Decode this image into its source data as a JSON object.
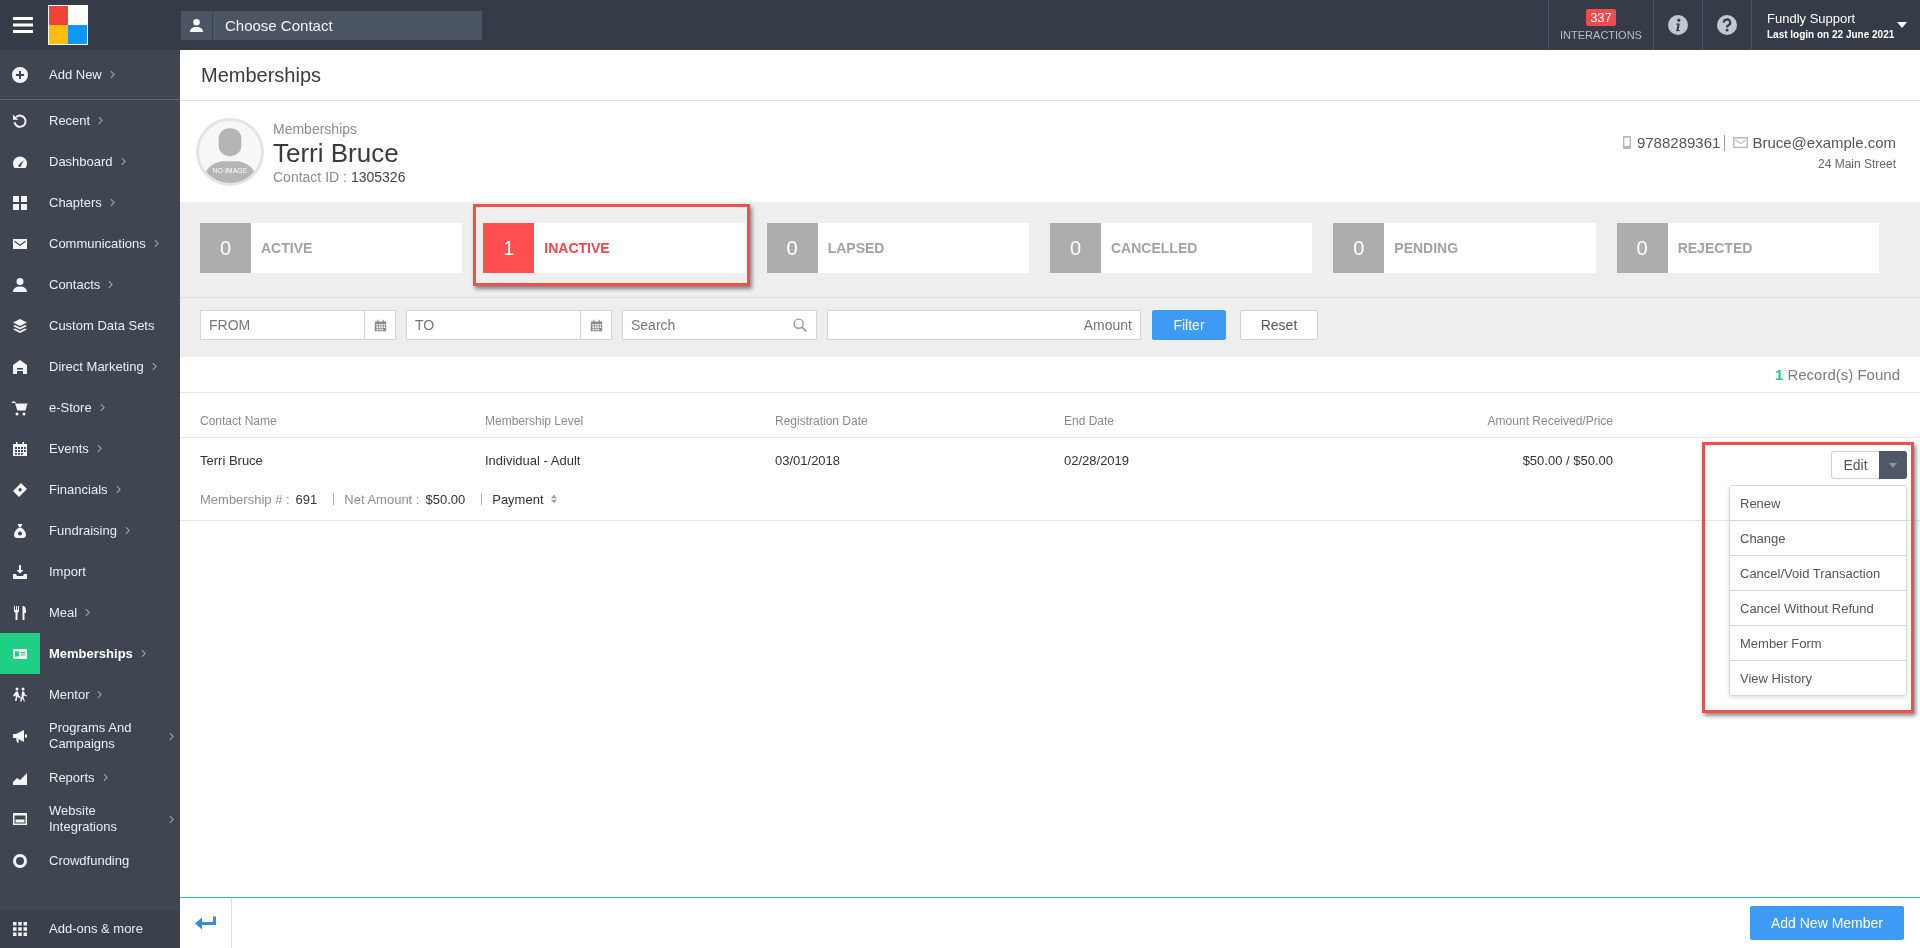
{
  "topbar": {
    "contact_picker": {
      "placeholder": "Choose Contact"
    },
    "interactions": {
      "count": "337",
      "label": "INTERACTIONS"
    },
    "user": {
      "name": "Fundly Support",
      "last_login": "Last login on 22 June 2021"
    }
  },
  "sidebar": {
    "add_new": {
      "label": "Add New",
      "submenu": true
    },
    "items": [
      {
        "label": "Recent",
        "submenu": true,
        "selected": false
      },
      {
        "label": "Dashboard",
        "submenu": true,
        "selected": false
      },
      {
        "label": "Chapters",
        "submenu": true,
        "selected": false
      },
      {
        "label": "Communications",
        "submenu": true,
        "selected": false
      },
      {
        "label": "Contacts",
        "submenu": true,
        "selected": false
      },
      {
        "label": "Custom Data Sets",
        "submenu": false,
        "selected": false
      },
      {
        "label": "Direct Marketing",
        "submenu": true,
        "selected": false
      },
      {
        "label": "e-Store",
        "submenu": true,
        "selected": false
      },
      {
        "label": "Events",
        "submenu": true,
        "selected": false
      },
      {
        "label": "Financials",
        "submenu": true,
        "selected": false
      },
      {
        "label": "Fundraising",
        "submenu": true,
        "selected": false
      },
      {
        "label": "Import",
        "submenu": false,
        "selected": false
      },
      {
        "label": "Meal",
        "submenu": true,
        "selected": false
      },
      {
        "label": "Memberships",
        "submenu": true,
        "selected": true
      },
      {
        "label": "Mentor",
        "submenu": true,
        "selected": false
      },
      {
        "label": "Programs And Campaigns",
        "submenu": true,
        "selected": false
      },
      {
        "label": "Reports",
        "submenu": true,
        "selected": false
      },
      {
        "label": "Website Integrations",
        "submenu": true,
        "selected": false
      },
      {
        "label": "Crowdfunding",
        "submenu": false,
        "selected": false
      }
    ],
    "footer": {
      "label": "Add-ons & more"
    }
  },
  "page": {
    "title": "Memberships"
  },
  "contact": {
    "section": "Memberships",
    "name": "Terri Bruce",
    "id_label": "Contact ID :",
    "id": "1305326",
    "avatar_caption": "NO IMAGE",
    "phone": "9788289361",
    "email": "Bruce@example.com",
    "address": "24 Main Street"
  },
  "status_tiles": [
    {
      "count": "0",
      "label": "ACTIVE",
      "selected": false,
      "highlighted": false
    },
    {
      "count": "1",
      "label": "INACTIVE",
      "selected": true,
      "highlighted": true
    },
    {
      "count": "0",
      "label": "LAPSED",
      "selected": false,
      "highlighted": false
    },
    {
      "count": "0",
      "label": "CANCELLED",
      "selected": false,
      "highlighted": false
    },
    {
      "count": "0",
      "label": "PENDING",
      "selected": false,
      "highlighted": false
    },
    {
      "count": "0",
      "label": "REJECTED",
      "selected": false,
      "highlighted": false
    }
  ],
  "filters": {
    "from": {
      "placeholder": "FROM"
    },
    "to": {
      "placeholder": "TO"
    },
    "search": {
      "placeholder": "Search"
    },
    "amount": {
      "placeholder": "Amount"
    },
    "buttons": [
      {
        "label": "Filter",
        "kind": "primary"
      },
      {
        "label": "Reset",
        "kind": "secondary"
      }
    ]
  },
  "results": {
    "count": "1",
    "label": "Record(s) Found"
  },
  "table": {
    "columns": [
      "Contact Name",
      "Membership Level",
      "Registration Date",
      "End Date",
      "Amount Received/Price"
    ],
    "rows": [
      {
        "cells": [
          "Terri Bruce",
          "Individual - Adult",
          "03/01/2018",
          "02/28/2019",
          "$50.00 / $50.00"
        ],
        "details": [
          {
            "label": "Membership # :",
            "value": "691"
          },
          {
            "label": "Net Amount :",
            "value": "$50.00"
          }
        ],
        "payment": "Payment",
        "action": {
          "label": "Edit",
          "expanded": true,
          "highlighted": true,
          "menu": [
            "Renew",
            "Change",
            "Cancel/Void Transaction",
            "Cancel Without Refund",
            "Member Form",
            "View History"
          ]
        }
      }
    ]
  },
  "footer": {
    "button": "Add New Member"
  }
}
